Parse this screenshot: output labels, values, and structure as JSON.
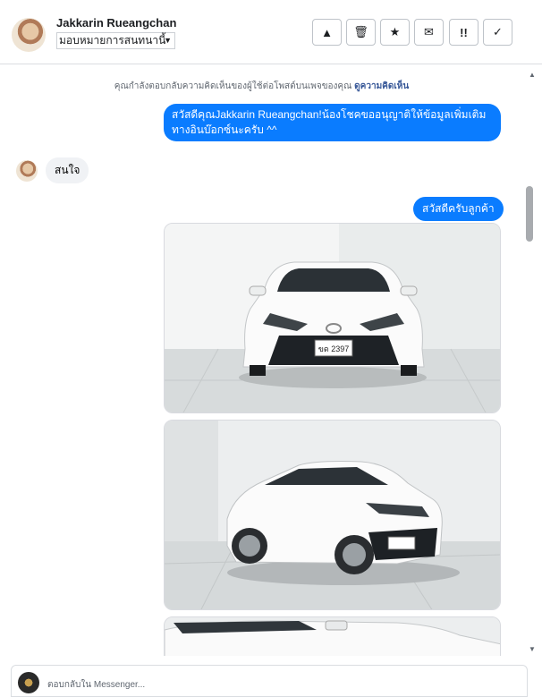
{
  "header": {
    "name": "Jakkarin Rueangchan",
    "assign_value": "มอบหมายการสนทนานี้",
    "actions": [
      {
        "icon": "warning-icon",
        "glyph": "▲"
      },
      {
        "icon": "trash-icon",
        "glyph": "🗑"
      },
      {
        "icon": "star-icon",
        "glyph": "★"
      },
      {
        "icon": "mail-icon",
        "glyph": "✉"
      },
      {
        "icon": "important-icon",
        "glyph": "!!"
      },
      {
        "icon": "checkmark-icon",
        "glyph": "✓"
      }
    ]
  },
  "thread": {
    "notice_text": "คุณกำลังตอบกลับความคิดเห็นของผู้ใช้ต่อโพสต์บนเพจของคุณ",
    "notice_link": "ดูความคิดเห็น",
    "messages": {
      "out_1": "สวัสดีคุณJakkarin Rueangchan!น้องโชคขออนุญาติให้ข้อมูลเพิ่มเติมทางอินบ๊อกซ์นะครับ ^^",
      "in_1": "สนใจ",
      "out_2": "สวัสดีครับลูกค้า"
    },
    "car_plate": "ขด 2397"
  },
  "composer": {
    "placeholder": "ตอบกลับใน Messenger..."
  },
  "colors": {
    "accent": "#0a7cff",
    "incoming_bubble": "#f0f2f5",
    "link": "#385898"
  }
}
